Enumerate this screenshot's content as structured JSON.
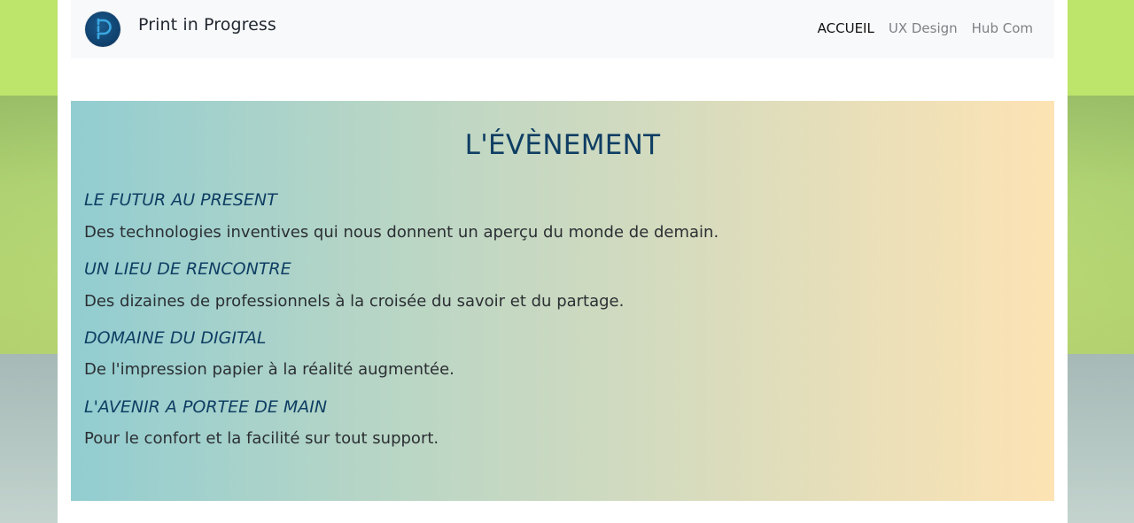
{
  "navbar": {
    "brand": "Print in Progress",
    "logo_icon": "print-in-progress-logo",
    "links": [
      {
        "label": "ACCUEIL",
        "active": true
      },
      {
        "label": "UX Design",
        "active": false
      },
      {
        "label": "Hub Com",
        "active": false
      }
    ]
  },
  "event": {
    "title": "L'ÉVÈNEMENT",
    "items": [
      {
        "heading": "LE FUTUR AU PRESENT",
        "text": "Des technologies inventives qui nous donnent un aperçu du monde de demain."
      },
      {
        "heading": "UN LIEU DE RENCONTRE",
        "text": "Des dizaines de professionnels à la croisée du savoir et du partage."
      },
      {
        "heading": "DOMAINE DU DIGITAL",
        "text": "De l'impression papier à la réalité augmentée."
      },
      {
        "heading": "L'AVENIR A PORTEE DE MAIN",
        "text": "Pour le confort et la facilité sur tout support."
      }
    ]
  },
  "colors": {
    "title_blue": "#0f3e63",
    "gradient_start": "#92cdd1",
    "gradient_end": "#fde3b4",
    "navbar_bg": "#f8f9fa"
  }
}
